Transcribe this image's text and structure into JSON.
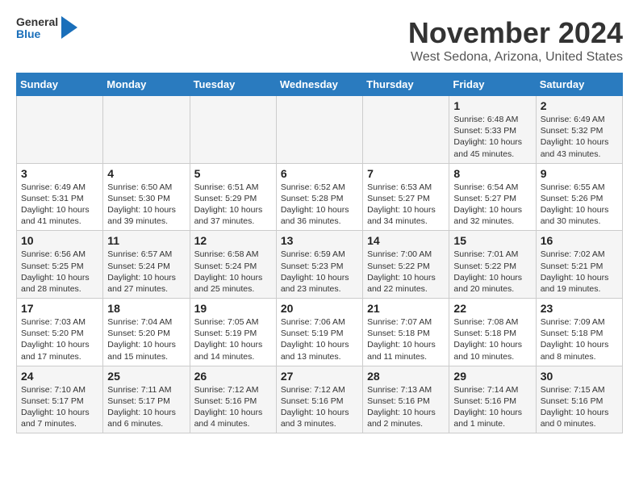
{
  "header": {
    "logo_general": "General",
    "logo_blue": "Blue",
    "month": "November 2024",
    "location": "West Sedona, Arizona, United States"
  },
  "days_of_week": [
    "Sunday",
    "Monday",
    "Tuesday",
    "Wednesday",
    "Thursday",
    "Friday",
    "Saturday"
  ],
  "weeks": [
    [
      {
        "day": "",
        "info": ""
      },
      {
        "day": "",
        "info": ""
      },
      {
        "day": "",
        "info": ""
      },
      {
        "day": "",
        "info": ""
      },
      {
        "day": "",
        "info": ""
      },
      {
        "day": "1",
        "info": "Sunrise: 6:48 AM\nSunset: 5:33 PM\nDaylight: 10 hours\nand 45 minutes."
      },
      {
        "day": "2",
        "info": "Sunrise: 6:49 AM\nSunset: 5:32 PM\nDaylight: 10 hours\nand 43 minutes."
      }
    ],
    [
      {
        "day": "3",
        "info": "Sunrise: 6:49 AM\nSunset: 5:31 PM\nDaylight: 10 hours\nand 41 minutes."
      },
      {
        "day": "4",
        "info": "Sunrise: 6:50 AM\nSunset: 5:30 PM\nDaylight: 10 hours\nand 39 minutes."
      },
      {
        "day": "5",
        "info": "Sunrise: 6:51 AM\nSunset: 5:29 PM\nDaylight: 10 hours\nand 37 minutes."
      },
      {
        "day": "6",
        "info": "Sunrise: 6:52 AM\nSunset: 5:28 PM\nDaylight: 10 hours\nand 36 minutes."
      },
      {
        "day": "7",
        "info": "Sunrise: 6:53 AM\nSunset: 5:27 PM\nDaylight: 10 hours\nand 34 minutes."
      },
      {
        "day": "8",
        "info": "Sunrise: 6:54 AM\nSunset: 5:27 PM\nDaylight: 10 hours\nand 32 minutes."
      },
      {
        "day": "9",
        "info": "Sunrise: 6:55 AM\nSunset: 5:26 PM\nDaylight: 10 hours\nand 30 minutes."
      }
    ],
    [
      {
        "day": "10",
        "info": "Sunrise: 6:56 AM\nSunset: 5:25 PM\nDaylight: 10 hours\nand 28 minutes."
      },
      {
        "day": "11",
        "info": "Sunrise: 6:57 AM\nSunset: 5:24 PM\nDaylight: 10 hours\nand 27 minutes."
      },
      {
        "day": "12",
        "info": "Sunrise: 6:58 AM\nSunset: 5:24 PM\nDaylight: 10 hours\nand 25 minutes."
      },
      {
        "day": "13",
        "info": "Sunrise: 6:59 AM\nSunset: 5:23 PM\nDaylight: 10 hours\nand 23 minutes."
      },
      {
        "day": "14",
        "info": "Sunrise: 7:00 AM\nSunset: 5:22 PM\nDaylight: 10 hours\nand 22 minutes."
      },
      {
        "day": "15",
        "info": "Sunrise: 7:01 AM\nSunset: 5:22 PM\nDaylight: 10 hours\nand 20 minutes."
      },
      {
        "day": "16",
        "info": "Sunrise: 7:02 AM\nSunset: 5:21 PM\nDaylight: 10 hours\nand 19 minutes."
      }
    ],
    [
      {
        "day": "17",
        "info": "Sunrise: 7:03 AM\nSunset: 5:20 PM\nDaylight: 10 hours\nand 17 minutes."
      },
      {
        "day": "18",
        "info": "Sunrise: 7:04 AM\nSunset: 5:20 PM\nDaylight: 10 hours\nand 15 minutes."
      },
      {
        "day": "19",
        "info": "Sunrise: 7:05 AM\nSunset: 5:19 PM\nDaylight: 10 hours\nand 14 minutes."
      },
      {
        "day": "20",
        "info": "Sunrise: 7:06 AM\nSunset: 5:19 PM\nDaylight: 10 hours\nand 13 minutes."
      },
      {
        "day": "21",
        "info": "Sunrise: 7:07 AM\nSunset: 5:18 PM\nDaylight: 10 hours\nand 11 minutes."
      },
      {
        "day": "22",
        "info": "Sunrise: 7:08 AM\nSunset: 5:18 PM\nDaylight: 10 hours\nand 10 minutes."
      },
      {
        "day": "23",
        "info": "Sunrise: 7:09 AM\nSunset: 5:18 PM\nDaylight: 10 hours\nand 8 minutes."
      }
    ],
    [
      {
        "day": "24",
        "info": "Sunrise: 7:10 AM\nSunset: 5:17 PM\nDaylight: 10 hours\nand 7 minutes."
      },
      {
        "day": "25",
        "info": "Sunrise: 7:11 AM\nSunset: 5:17 PM\nDaylight: 10 hours\nand 6 minutes."
      },
      {
        "day": "26",
        "info": "Sunrise: 7:12 AM\nSunset: 5:16 PM\nDaylight: 10 hours\nand 4 minutes."
      },
      {
        "day": "27",
        "info": "Sunrise: 7:12 AM\nSunset: 5:16 PM\nDaylight: 10 hours\nand 3 minutes."
      },
      {
        "day": "28",
        "info": "Sunrise: 7:13 AM\nSunset: 5:16 PM\nDaylight: 10 hours\nand 2 minutes."
      },
      {
        "day": "29",
        "info": "Sunrise: 7:14 AM\nSunset: 5:16 PM\nDaylight: 10 hours\nand 1 minute."
      },
      {
        "day": "30",
        "info": "Sunrise: 7:15 AM\nSunset: 5:16 PM\nDaylight: 10 hours\nand 0 minutes."
      }
    ]
  ]
}
